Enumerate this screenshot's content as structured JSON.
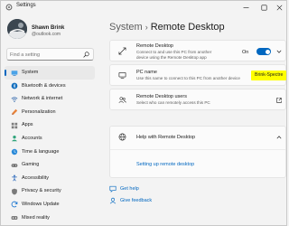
{
  "window": {
    "title": "Settings"
  },
  "user": {
    "name": "Shawn Brink",
    "email": "@outlook.com"
  },
  "search": {
    "placeholder": "Find a setting"
  },
  "nav": {
    "items": [
      {
        "label": "System",
        "icon": "system-icon",
        "active": true
      },
      {
        "label": "Bluetooth & devices",
        "icon": "bluetooth-icon"
      },
      {
        "label": "Network & internet",
        "icon": "network-icon"
      },
      {
        "label": "Personalization",
        "icon": "personalization-icon"
      },
      {
        "label": "Apps",
        "icon": "apps-icon"
      },
      {
        "label": "Accounts",
        "icon": "accounts-icon"
      },
      {
        "label": "Time & language",
        "icon": "time-language-icon"
      },
      {
        "label": "Gaming",
        "icon": "gaming-icon"
      },
      {
        "label": "Accessibility",
        "icon": "accessibility-icon"
      },
      {
        "label": "Privacy & security",
        "icon": "privacy-icon"
      },
      {
        "label": "Windows Update",
        "icon": "windows-update-icon"
      },
      {
        "label": "Mixed reality",
        "icon": "mixed-reality-icon"
      }
    ]
  },
  "breadcrumb": {
    "parent": "System",
    "separator": "›",
    "current": "Remote Desktop"
  },
  "remote_desktop": {
    "title": "Remote Desktop",
    "subtitle_line1": "Connect to and use this PC from another",
    "subtitle_line2": "device using the Remote Desktop app",
    "toggle_label": "On",
    "enabled": true
  },
  "pc_name": {
    "title": "PC name",
    "subtitle": "Use this name to connect to this PC from another device",
    "value": "Brink-Spectre"
  },
  "remote_users": {
    "title": "Remote Desktop users",
    "subtitle": "Select who can remotely access this PC"
  },
  "help": {
    "title": "Help with Remote Desktop",
    "link": "Setting up remote desktop"
  },
  "footer": {
    "get_help": "Get help",
    "give_feedback": "Give feedback"
  },
  "colors": {
    "accent": "#0067c0",
    "highlight": "#ffff00"
  }
}
